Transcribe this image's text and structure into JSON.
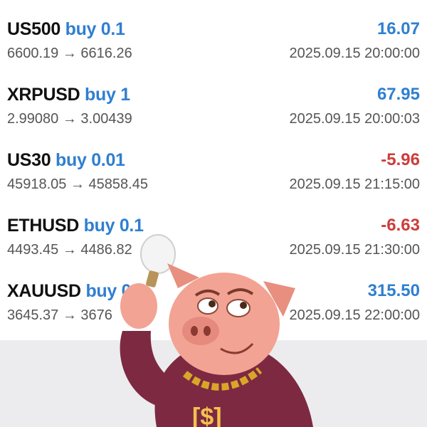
{
  "trades": [
    {
      "symbol": "US500",
      "side": "buy 0.1",
      "profit": "16.07",
      "prices": "6600.19 → 6616.26",
      "time": "2025.09.15 20:00:00",
      "profit_color": "#2f7fd0"
    },
    {
      "symbol": "XRPUSD",
      "side": "buy 1",
      "profit": "67.95",
      "prices": "2.99080 → 3.00439",
      "time": "2025.09.15 20:00:03",
      "profit_color": "#2f7fd0"
    },
    {
      "symbol": "US30",
      "side": "buy 0.01",
      "profit": "-5.96",
      "prices": "45918.05 → 45858.45",
      "time": "2025.09.15 21:15:00",
      "profit_color": "#cf3b3b"
    },
    {
      "symbol": "ETHUSD",
      "side": "buy 0.1",
      "profit": "-6.63",
      "prices": "4493.45 → 4486.82",
      "time": "2025.09.15 21:30:00",
      "profit_color": "#cf3b3b"
    },
    {
      "symbol": "XAUUSD",
      "side": "buy 0.1",
      "profit": "315.50",
      "prices": "3645.37 → 3676",
      "time": "2025.09.15 22:00:00",
      "profit_color": "#2f7fd0"
    }
  ],
  "mascot": {
    "icon": "pig-with-lightbulb-icon",
    "hoodie_text": "$"
  }
}
